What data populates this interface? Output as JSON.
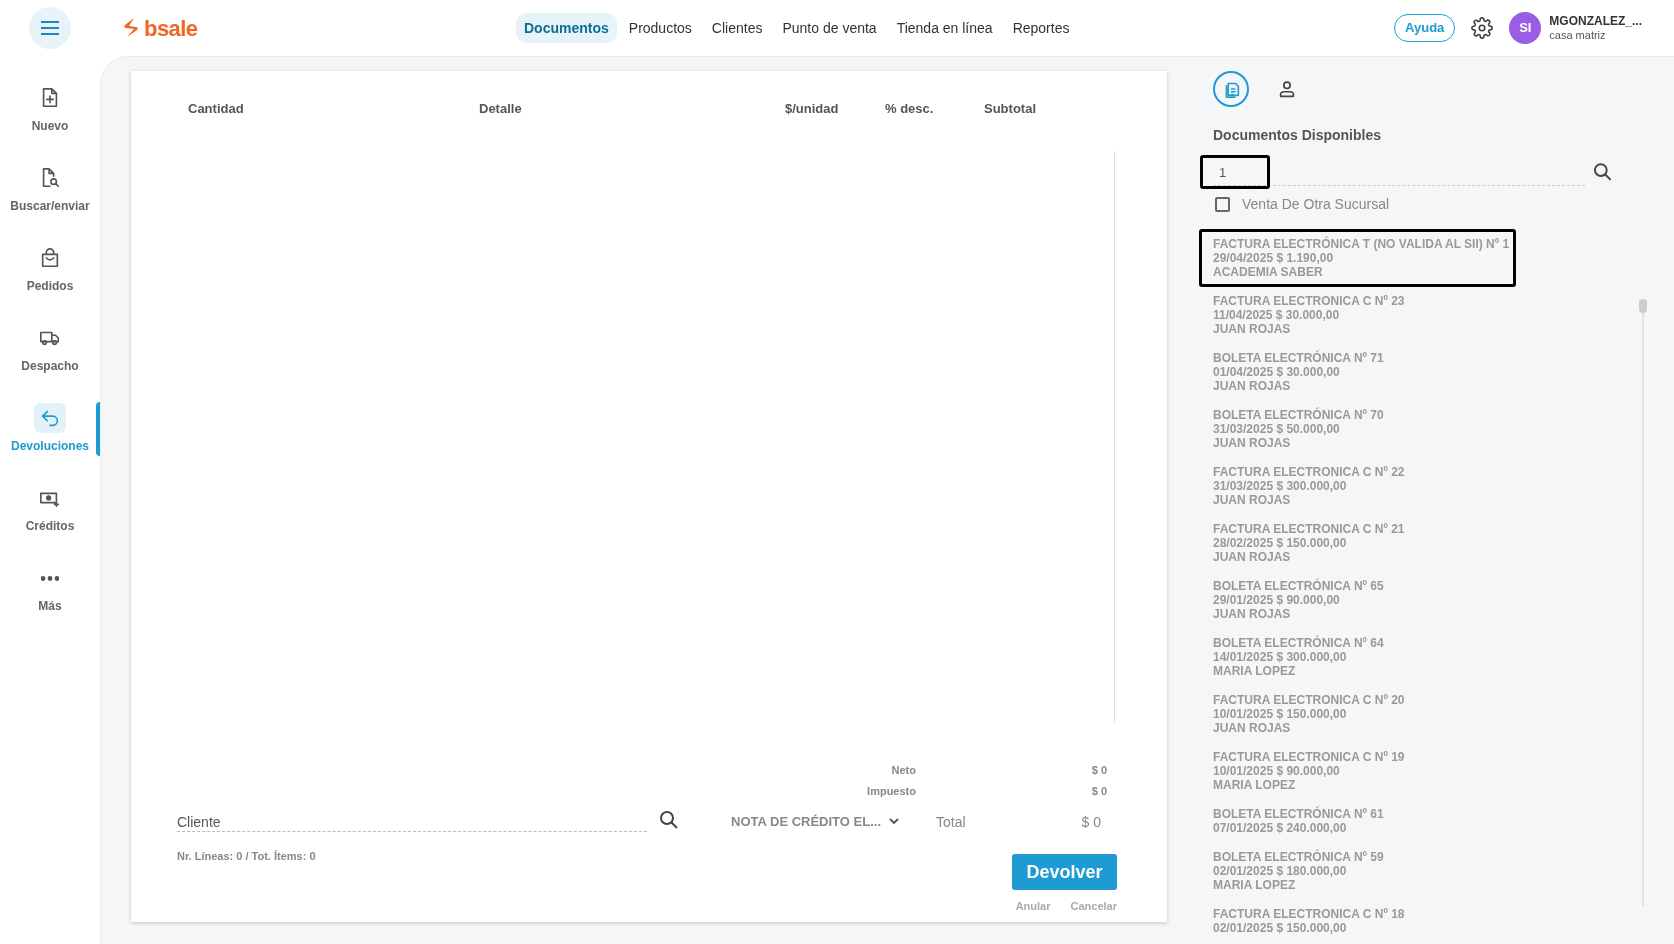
{
  "header": {
    "logo": "bsale",
    "nav": [
      {
        "label": "Documentos",
        "selected": true
      },
      {
        "label": "Productos",
        "selected": false
      },
      {
        "label": "Clientes",
        "selected": false
      },
      {
        "label": "Punto de venta",
        "selected": false
      },
      {
        "label": "Tienda en línea",
        "selected": false
      },
      {
        "label": "Reportes",
        "selected": false
      }
    ],
    "help": "Ayuda",
    "user": {
      "initials": "SI",
      "name": "MGONZALEZ_...",
      "branch": "casa matriz"
    }
  },
  "sidebar": {
    "items": [
      {
        "label": "Nuevo",
        "selected": false
      },
      {
        "label": "Buscar/enviar",
        "selected": false
      },
      {
        "label": "Pedidos",
        "selected": false
      },
      {
        "label": "Despacho",
        "selected": false
      },
      {
        "label": "Devoluciones",
        "selected": true
      },
      {
        "label": "Créditos",
        "selected": false
      },
      {
        "label": "Más",
        "selected": false
      }
    ]
  },
  "table": {
    "columns": [
      "Cantidad",
      "Detalle",
      "$/unidad",
      "% desc.",
      "Subtotal"
    ]
  },
  "totals": [
    {
      "label": "Neto",
      "value": "$ 0"
    },
    {
      "label": "Impuesto",
      "value": "$ 0"
    }
  ],
  "client": {
    "placeholder": "Cliente"
  },
  "doc_type": "NOTA DE CRÉDITO EL...",
  "total": {
    "label": "Total",
    "value": "$ 0"
  },
  "counts": "Nr. Líneas: 0 / Tot. Ítems: 0",
  "actions": {
    "primary": "Devolver",
    "links": [
      "Anular",
      "Cancelar"
    ]
  },
  "panel": {
    "tabs": [
      {
        "selected": true
      },
      {
        "selected": false
      }
    ],
    "title": "Documentos Disponibles",
    "search": {
      "value": "1",
      "highlighted": true
    },
    "other_branch": {
      "label": "Venta De Otra Sucursal",
      "checked": false
    },
    "documents": [
      {
        "title": "FACTURA ELECTRÓNICA T (NO VALIDA AL SII) Nº 1",
        "detail": "29/04/2025 $ 1.190,00",
        "client": "ACADEMIA SABER",
        "highlighted": true
      },
      {
        "title": "FACTURA ELECTRONICA C Nº 23",
        "detail": "11/04/2025 $ 30.000,00",
        "client": "JUAN ROJAS",
        "highlighted": false
      },
      {
        "title": "BOLETA ELECTRÓNICA Nº 71",
        "detail": "01/04/2025 $ 30.000,00",
        "client": "JUAN ROJAS",
        "highlighted": false
      },
      {
        "title": "BOLETA ELECTRÓNICA Nº 70",
        "detail": "31/03/2025 $ 50.000,00",
        "client": "JUAN ROJAS",
        "highlighted": false
      },
      {
        "title": "FACTURA ELECTRONICA C Nº 22",
        "detail": "31/03/2025 $ 300.000,00",
        "client": "JUAN ROJAS",
        "highlighted": false
      },
      {
        "title": "FACTURA ELECTRONICA C Nº 21",
        "detail": "28/02/2025 $ 150.000,00",
        "client": "JUAN ROJAS",
        "highlighted": false
      },
      {
        "title": "BOLETA ELECTRÓNICA Nº 65",
        "detail": "29/01/2025 $ 90.000,00",
        "client": "JUAN ROJAS",
        "highlighted": false
      },
      {
        "title": "BOLETA ELECTRÓNICA Nº 64",
        "detail": "14/01/2025 $ 300.000,00",
        "client": "MARIA LOPEZ",
        "highlighted": false
      },
      {
        "title": "FACTURA ELECTRONICA C Nº 20",
        "detail": "10/01/2025 $ 150.000,00",
        "client": "JUAN ROJAS",
        "highlighted": false
      },
      {
        "title": "FACTURA ELECTRONICA C Nº 19",
        "detail": "10/01/2025 $ 90.000,00",
        "client": "MARIA LOPEZ",
        "highlighted": false
      },
      {
        "title": "BOLETA ELECTRÓNICA Nº 61",
        "detail": "07/01/2025 $ 240.000,00",
        "highlighted": false
      },
      {
        "title": "BOLETA ELECTRÓNICA Nº 59",
        "detail": "02/01/2025 $ 180.000,00",
        "client": "MARIA LOPEZ",
        "highlighted": false
      },
      {
        "title": "FACTURA ELECTRONICA C Nº 18",
        "detail": "02/01/2025 $ 150.000,00",
        "highlighted": false
      }
    ]
  }
}
